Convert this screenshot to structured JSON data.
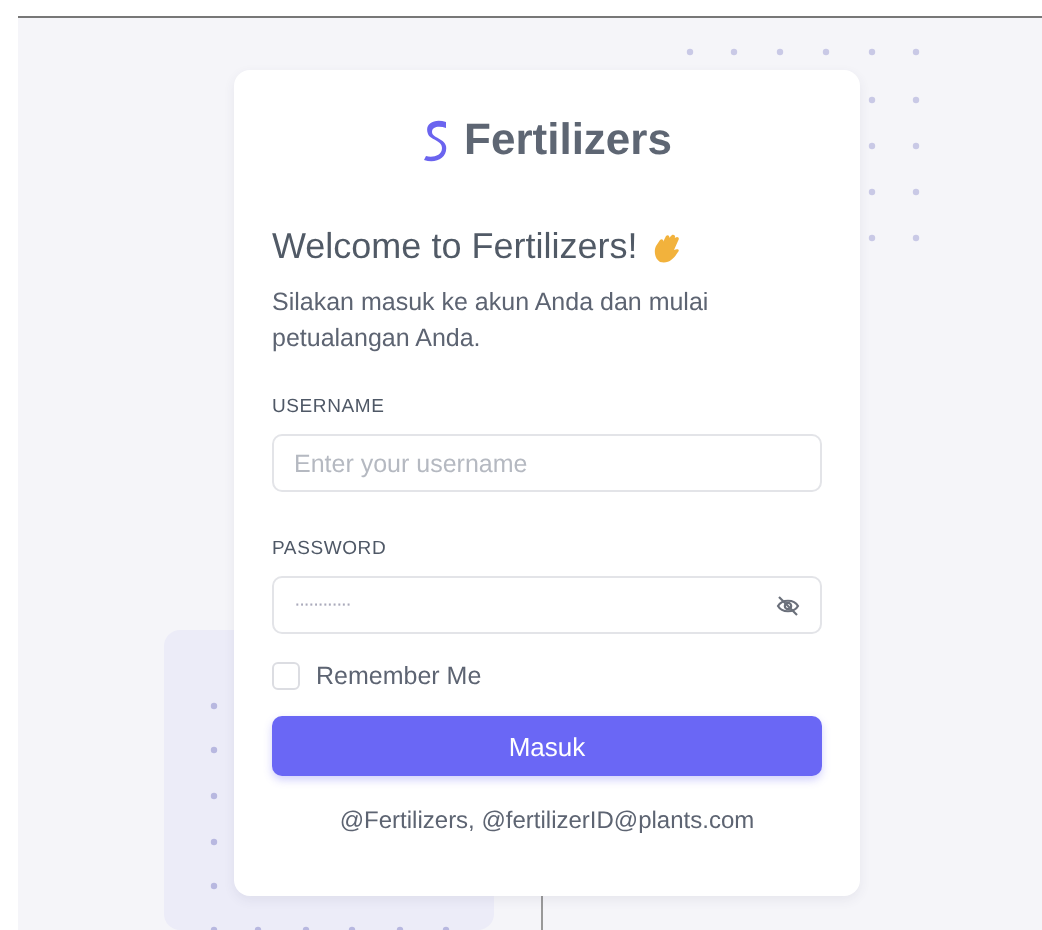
{
  "brand": {
    "name": "Fertilizers"
  },
  "heading": "Welcome to Fertilizers!",
  "subtitle": "Silakan masuk ke akun Anda dan mulai petualangan Anda.",
  "fields": [
    {
      "kind": "text",
      "label": "USERNAME",
      "placeholder": "Enter your username"
    },
    {
      "kind": "password",
      "label": "PASSWORD",
      "value": "············"
    }
  ],
  "remember": {
    "label": "Remember Me",
    "checked": false
  },
  "submit": "Masuk",
  "footer": "@Fertilizers, @fertilizerID@plants.com"
}
